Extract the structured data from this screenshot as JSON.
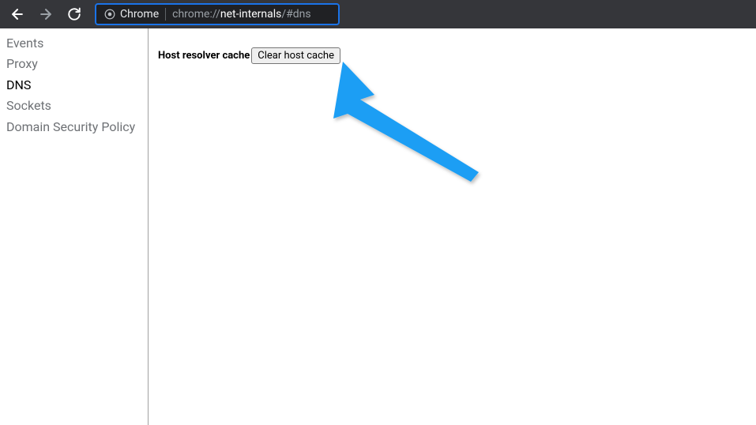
{
  "toolbar": {
    "chrome_label": "Chrome",
    "url_scheme": "chrome://",
    "url_host": "net-internals",
    "url_path": "/#dns"
  },
  "sidebar": {
    "items": [
      {
        "label": "Events",
        "active": false
      },
      {
        "label": "Proxy",
        "active": false
      },
      {
        "label": "DNS",
        "active": true
      },
      {
        "label": "Sockets",
        "active": false
      },
      {
        "label": "Domain Security Policy",
        "active": false
      }
    ]
  },
  "main": {
    "host_resolver_label": "Host resolver cache",
    "clear_button_label": "Clear host cache"
  }
}
